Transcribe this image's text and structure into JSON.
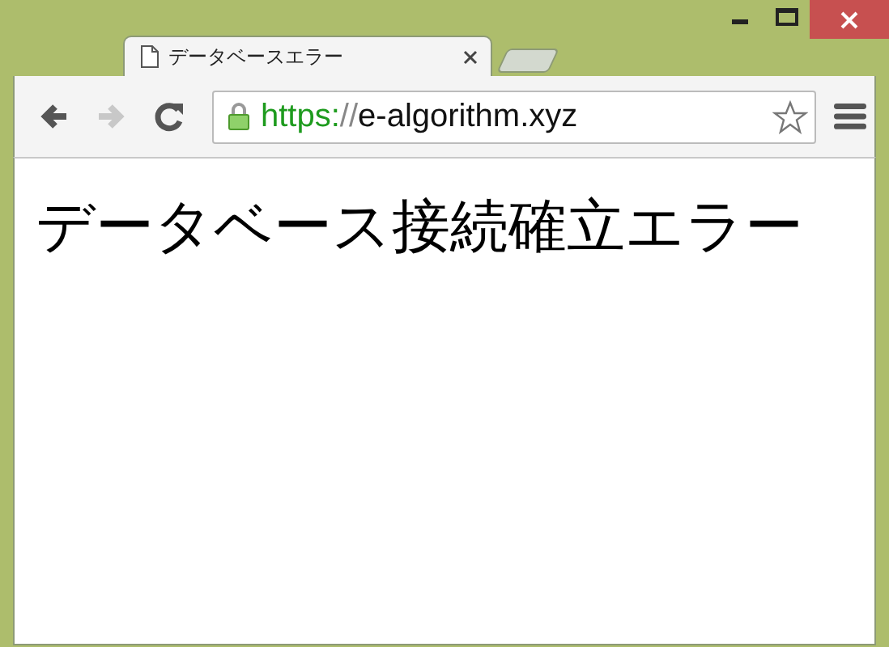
{
  "tab": {
    "title": "データベースエラー",
    "selected": true
  },
  "nav_buttons": [
    {
      "kind": "back",
      "disabled": false
    },
    {
      "kind": "forward",
      "disabled": true
    },
    {
      "kind": "reload",
      "disabled": false
    }
  ],
  "address_bar": {
    "secure": true,
    "scheme": "https:",
    "separator": "//",
    "host": "e-algorithm.xyz",
    "bookmarked": false
  },
  "page": {
    "heading": "データベース接続確立エラー"
  }
}
